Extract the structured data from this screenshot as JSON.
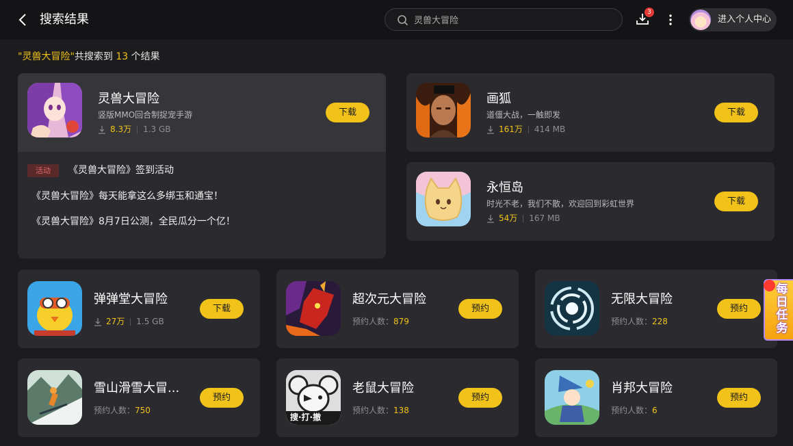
{
  "header": {
    "title": "搜索结果",
    "search_value": "灵兽大冒险",
    "download_count": "3",
    "profile_label": "进入个人中心"
  },
  "summary": {
    "query": "\"灵兽大冒险\"",
    "prefix": "共搜索到",
    "count": "13",
    "suffix": "个结果"
  },
  "featured": {
    "name": "灵兽大冒险",
    "desc": "竖版MMO回合制捉宠手游",
    "downloads": "8.3万",
    "size": "1.3 GB",
    "button": "下载",
    "event_tag": "活动",
    "event_title": "《灵兽大冒险》签到活动",
    "news": [
      "《灵兽大冒险》每天能拿这么多绑玉和通宝！",
      "《灵兽大冒险》8月7日公测，全民瓜分一个亿！"
    ]
  },
  "side_apps": [
    {
      "name": "画狐",
      "desc": "道僵大战，一触即发",
      "downloads": "161万",
      "size": "414 MB",
      "button": "下载"
    },
    {
      "name": "永恒岛",
      "desc": "时光不老，我们不散，欢迎回到彩虹世界",
      "downloads": "54万",
      "size": "167 MB",
      "button": "下载"
    }
  ],
  "grid_apps": [
    {
      "name": "弹弹堂大冒险",
      "downloads": "27万",
      "size": "1.5 GB",
      "button": "下载"
    },
    {
      "name": "超次元大冒险",
      "reserve_label": "预约人数：",
      "reserve_count": "879",
      "button": "预约"
    },
    {
      "name": "无限大冒险",
      "reserve_label": "预约人数：",
      "reserve_count": "228",
      "button": "预约"
    },
    {
      "name": "雪山滑雪大冒...",
      "reserve_label": "预约人数：",
      "reserve_count": "750",
      "button": "预约"
    },
    {
      "name": "老鼠大冒险",
      "reserve_label": "预约人数：",
      "reserve_count": "138",
      "button": "预约",
      "icon_text": "搜·打·撤"
    },
    {
      "name": "肖邦大冒险",
      "reserve_label": "预约人数：",
      "reserve_count": "6",
      "button": "预约"
    }
  ],
  "daily_task": "每日任务",
  "icons": [
    "back-icon",
    "search-icon",
    "download-manager-icon",
    "more-icon",
    "download-icon"
  ],
  "colors": {
    "accent": "#f0c21a",
    "badge": "#e53935",
    "background": "#1c1c1f",
    "card": "#2b2b2f"
  }
}
